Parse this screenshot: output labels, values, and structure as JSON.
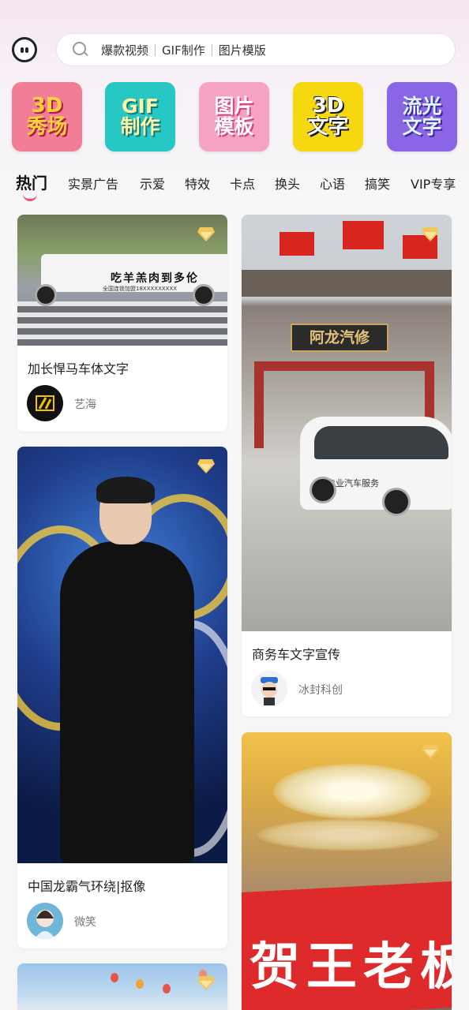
{
  "search": {
    "keywords": [
      "爆款视频",
      "GIF制作",
      "图片模版"
    ]
  },
  "features": [
    {
      "line1": "3D",
      "line2": "秀场"
    },
    {
      "line1": "GIF",
      "line2": "制作"
    },
    {
      "line1": "图片",
      "line2": "模板"
    },
    {
      "line1": "3D",
      "line2": "文字"
    },
    {
      "line1": "流光",
      "line2": "文字"
    }
  ],
  "tabs": [
    "热门",
    "实景广告",
    "示爱",
    "特效",
    "卡点",
    "换头",
    "心语",
    "搞笑",
    "VIP专享"
  ],
  "active_tab": "热门",
  "cards": [
    {
      "title": "加长悍马车体文字",
      "author": "艺海",
      "image_text": "吃羊羔肉到多伦",
      "image_subtext": "全国连锁加盟18XXXXXXXXX"
    },
    {
      "title": "商务车文字宣传",
      "author": "冰封科创",
      "image_sign": "阿龙汽修",
      "image_text": "专业汽车服务"
    },
    {
      "title": "中国龙霸气环绕|抠像",
      "author": "微笑"
    },
    {
      "image_text": "贺王老板"
    }
  ],
  "colors": {
    "accent": "#f0506e",
    "vip_badge": "#f2c75c"
  }
}
